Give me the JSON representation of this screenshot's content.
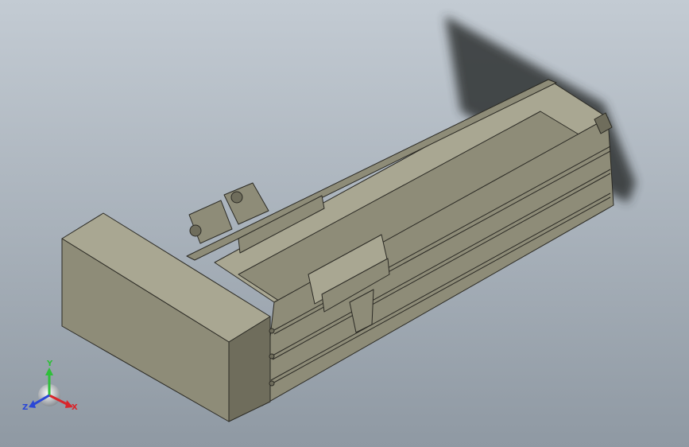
{
  "viewport": {
    "background_top": "#c3cbd3",
    "background_bottom": "#8f99a3",
    "model_body_color": "#8e8c78",
    "model_dark_color": "#6f6d5c",
    "model_light_color": "#a9a792",
    "edge_color": "#2b2a24",
    "shadow_color": "#2e3133"
  },
  "triad": {
    "x_label": "X",
    "y_label": "Y",
    "z_label": "Z",
    "x_color": "#d9262b",
    "y_color": "#2fbf3a",
    "z_color": "#2a47d6"
  }
}
